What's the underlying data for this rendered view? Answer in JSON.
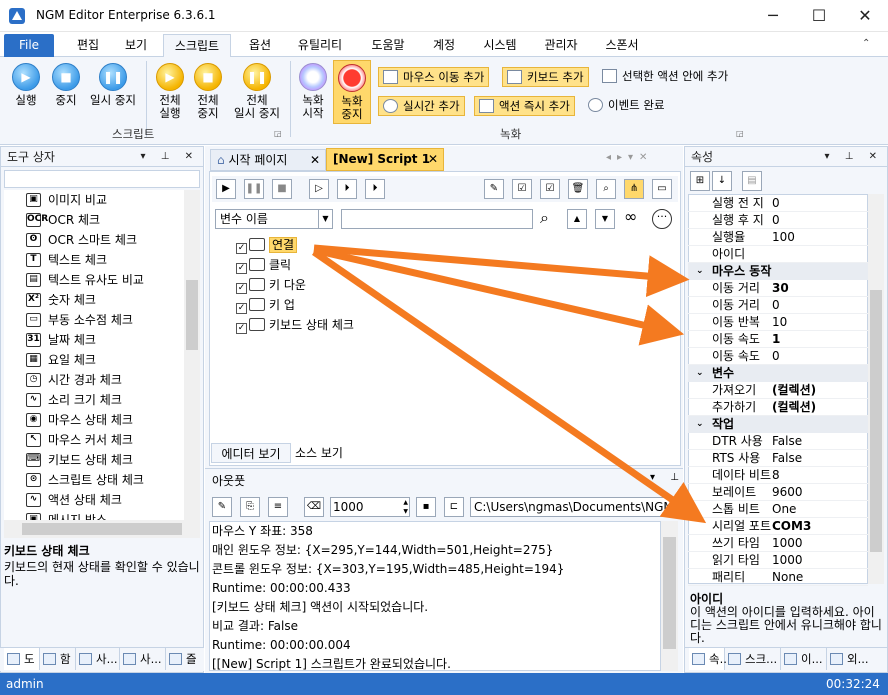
{
  "window": {
    "title": "NGM Editor",
    "edition": "Enterprise 6.3.6.1",
    "minimize": "─",
    "maximize": "☐",
    "close": "✕"
  },
  "ribbon_tabs": [
    "File",
    "편집",
    "보기",
    "스크립트",
    "옵션",
    "유틸리티",
    "도움말",
    "계정",
    "시스템",
    "관리자",
    "스폰서"
  ],
  "ribbon": {
    "script_group": {
      "label": "스크립트",
      "run": "실행",
      "stop": "중지",
      "pause": "일시 중지",
      "run_all_1": "전체",
      "run_all_2": "실행",
      "stop_all_1": "전체",
      "stop_all_2": "중지",
      "pause_all_1": "전체",
      "pause_all_2": "일시 중지"
    },
    "record_group": {
      "label": "녹화",
      "rec_start_1": "녹화",
      "rec_start_2": "시작",
      "rec_stop_1": "녹화",
      "rec_stop_2": "중지",
      "mouse_move": "마우스 이동 추가",
      "keyboard": "키보드 추가",
      "realtime": "실시간 추가",
      "action_now": "액션 즉시 추가",
      "in_selected": "선택한 액션 안에 추가",
      "event_done": "이벤트 완료"
    }
  },
  "toolbox": {
    "title": "도구 상자",
    "items": [
      "이미지 비교",
      "OCR 체크",
      "OCR 스마트 체크",
      "텍스트 체크",
      "텍스트 유사도 비교",
      "숫자 체크",
      "부동 소수점 체크",
      "날짜 체크",
      "요일 체크",
      "시간 경과 체크",
      "소리 크기 체크",
      "마우스 상태 체크",
      "마우스 커서 체크",
      "키보드 상태 체크",
      "스크립트 상태 체크",
      "액션 상태 체크",
      "메시지 박스"
    ],
    "desc_title": "키보드 상태 체크",
    "desc_text": "키보드의 현재 상태를 확인할 수 있습니다.",
    "bottom_tabs": [
      "도",
      "함",
      "사...",
      "사...",
      "즐"
    ]
  },
  "editor": {
    "tabs": [
      "시작 페이지",
      "[New] Script 1"
    ],
    "var_select": "변수 이름",
    "nodes": [
      "연결",
      "클릭",
      "키 다운",
      "키 업",
      "키보드 상태 체크"
    ],
    "view_tabs": [
      "에디터 보기",
      "소스 보기"
    ]
  },
  "output": {
    "title": "아웃풋",
    "counter": "1000",
    "path": "C:\\Users\\ngmas\\Documents\\NGM6\\",
    "lines": [
      "마우스 Y 좌표: 358",
      "매인 윈도우 정보: {X=295,Y=144,Width=501,Height=275}",
      "콘트롤 윈도우 정보: {X=303,Y=195,Width=485,Height=194}",
      "Runtime: 00:00:00.433",
      "[키보드 상태 체크] 액션이 시작되었습니다.",
      "비교 결과: False",
      "Runtime: 00:00:00.004",
      "[[New] Script 1] 스크립트가 완료되었습니다."
    ]
  },
  "properties": {
    "title": "속성",
    "rows_top": [
      [
        "실행 전 지",
        "0"
      ],
      [
        "실행 후 지",
        "0"
      ],
      [
        "실행율",
        "100"
      ],
      [
        "아이디",
        ""
      ]
    ],
    "cat_mouse": "마우스 동작",
    "rows_mouse": [
      [
        "이동 거리",
        "30"
      ],
      [
        "이동 거리",
        "0"
      ],
      [
        "이동 반복",
        "10"
      ],
      [
        "이동 속도",
        "1"
      ],
      [
        "이동 속도",
        "0"
      ]
    ],
    "cat_var": "변수",
    "rows_var": [
      [
        "가져오기",
        "(컬렉션)"
      ],
      [
        "추가하기",
        "(컬렉션)"
      ]
    ],
    "cat_work": "작업",
    "rows_work": [
      [
        "DTR 사용",
        "False"
      ],
      [
        "RTS 사용",
        "False"
      ],
      [
        "데이타 비트",
        "8"
      ],
      [
        "보레이트",
        "9600"
      ],
      [
        "스톱 비트",
        "One"
      ],
      [
        "시리얼 포트",
        "COM3"
      ],
      [
        "쓰기 타임",
        "1000"
      ],
      [
        "읽기 타임",
        "1000"
      ],
      [
        "패리티",
        "None"
      ]
    ],
    "desc_title": "아이디",
    "desc_text": "이 액션의 아이디를 입력하세요. 아이디는 스크립트 안에서 유니크해야 합니다.",
    "bottom_tabs": [
      "속...",
      "스크...",
      "이...",
      "외..."
    ]
  },
  "status": {
    "user": "admin",
    "time": "00:32:24"
  },
  "colors": {
    "accent": "#2b6fc7",
    "arrow": "#f47a20",
    "highlight": "#ffd86b"
  }
}
